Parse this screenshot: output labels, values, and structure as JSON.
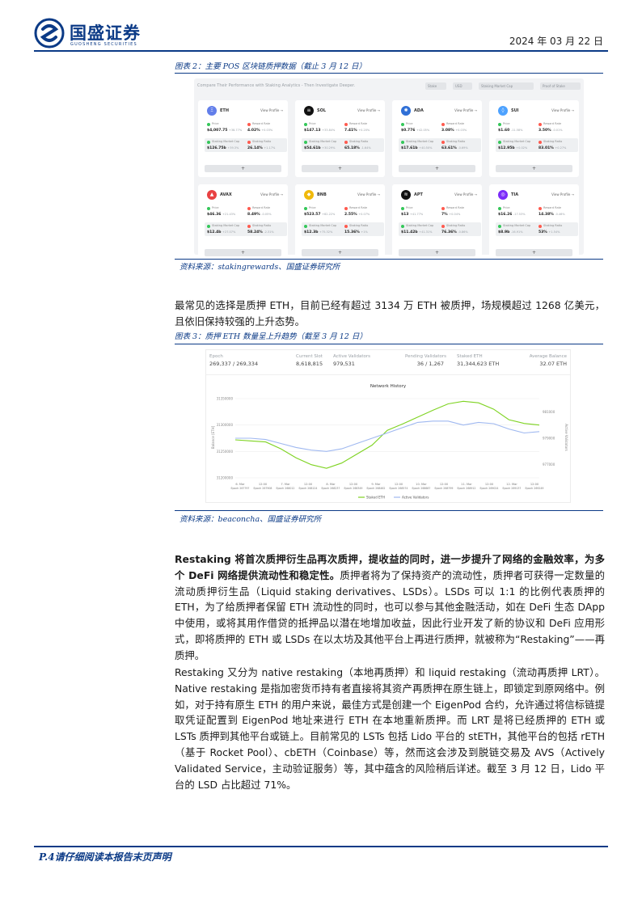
{
  "header": {
    "logo_text": "国盛证券",
    "logo_sub": "GUOSHENG SECURITIES",
    "date": "2024 年 03 月 22 日"
  },
  "figure2": {
    "caption": "图表 2：主要 POS 区块链质押数据（截止 3 月 12 日）",
    "source": "资料来源：stakingrewards、国盛证券研究所",
    "dashboard": {
      "heading": "Compare Their Performance with Staking Analytics - Then Investigate Deeper.",
      "filters": [
        "Stake",
        "USD",
        "Staking Market Cap",
        "Proof of Stake"
      ],
      "view_label": "View Profile →",
      "plus": "+",
      "metric_labels": [
        "Price",
        "Reward Rate",
        "Staking Market Cap",
        "Staking Ratio"
      ],
      "cards": [
        {
          "name": "ETH",
          "icon": "Ξ",
          "color": "#627eea",
          "price": "$4,007.75",
          "price_chg": "+38.77%",
          "reward": "4.02%",
          "reward_chg": "+0.03%",
          "mcap": "$126.75b",
          "mcap_chg": "+39.3%",
          "ratio": "26.14%",
          "ratio_chg": "+1.17%"
        },
        {
          "name": "SOL",
          "icon": "≡",
          "color": "#111111",
          "price": "$147.13",
          "price_chg": "+33.84%",
          "reward": "7.41%",
          "reward_chg": "+0.20%",
          "mcap": "$54.61b",
          "mcap_chg": "+30.29%",
          "ratio": "65.18%",
          "ratio_chg": "-1.64%"
        },
        {
          "name": "ADA",
          "icon": "✺",
          "color": "#2f6fd6",
          "price": "$0.776",
          "price_chg": "+42.05%",
          "reward": "3.08%",
          "reward_chg": "+0.03%",
          "mcap": "$17.61b",
          "mcap_chg": "+40.50%",
          "ratio": "63.61%",
          "ratio_chg": "-0.69%"
        },
        {
          "name": "SUI",
          "icon": "◊",
          "color": "#4da2ff",
          "price": "$1.60",
          "price_chg": "-11.58%",
          "reward": "3.50%",
          "reward_chg": "-0.01%",
          "mcap": "$12.95b",
          "mcap_chg": "+0.02%",
          "ratio": "83.01%",
          "ratio_chg": "+0.27%"
        },
        {
          "name": "AVAX",
          "icon": "▲",
          "color": "#e84142",
          "price": "$46.36",
          "price_chg": "+21.43%",
          "reward": "8.49%",
          "reward_chg": "-0.05%",
          "mcap": "$12.4b",
          "mcap_chg": "+27.07%",
          "ratio": "58.24%",
          "ratio_chg": "-2.31%"
        },
        {
          "name": "BNB",
          "icon": "◆",
          "color": "#f0b90b",
          "price": "$523.57",
          "price_chg": "+82.22%",
          "reward": "2.55%",
          "reward_chg": "+0.07%",
          "mcap": "$12.3b",
          "mcap_chg": "+75.32%",
          "ratio": "15.36%",
          "ratio_chg": "+1%"
        },
        {
          "name": "APT",
          "icon": "≋",
          "color": "#111111",
          "price": "$13",
          "price_chg": "+41.77%",
          "reward": "7%",
          "reward_chg": "+0.04%",
          "mcap": "$11.42b",
          "mcap_chg": "+41.31%",
          "ratio": "76.36%",
          "ratio_chg": "-0.86%"
        },
        {
          "name": "TIA",
          "icon": "◎",
          "color": "#7b2bf9",
          "price": "$16.26",
          "price_chg": "-17.53%",
          "reward": "14.38%",
          "reward_chg": "-0.46%",
          "mcap": "$8.9b",
          "mcap_chg": "-16.91%",
          "ratio": "53%",
          "ratio_chg": "+1.54%"
        }
      ]
    }
  },
  "paragraph1": "最常见的选择是质押 ETH，目前已经有超过 3134 万 ETH 被质押，场规模超过 1268 亿美元，且依旧保持较强的上升态势。",
  "figure3": {
    "caption": "图表 3：质押 ETH 数量呈上升趋势（截至 3 月 12 日）",
    "source": "资料来源：beaconcha、国盛证券研究所",
    "stats": [
      {
        "label": "Epoch",
        "value": "269,337 / 269,334"
      },
      {
        "label": "Current Slot",
        "value": "8,618,815"
      },
      {
        "label": "Active Validators",
        "value": "979,531"
      },
      {
        "label": "Pending Validators",
        "value": "36 / 1,267"
      },
      {
        "label": "Staked ETH",
        "value": "31,344,623 ETH"
      },
      {
        "label": "Average Balance",
        "value": "32.07 ETH"
      }
    ]
  },
  "chart_data": {
    "type": "line",
    "title": "Network History",
    "ylabel": "Balance [ETH]",
    "y2label": "Active Validators",
    "x": [
      "6. Mar",
      "12:00",
      "7. Mar",
      "12:00",
      "8. Mar",
      "12:00",
      "9. Mar",
      "12:00",
      "10. Mar",
      "12:00",
      "11. Mar",
      "12:00",
      "12. Mar",
      "12:00"
    ],
    "x_epochs": [
      "Epoch 267797",
      "Epoch 267908",
      "Epoch 268012",
      "Epoch 268124",
      "Epoch 268237",
      "Epoch 268349",
      "Epoch 268462",
      "Epoch 268574",
      "Epoch 268687",
      "Epoch 268799",
      "Epoch 268912",
      "Epoch 269024",
      "Epoch 269137",
      "Epoch 269249"
    ],
    "y_ticks": [
      "31200000",
      "31250000",
      "31300000",
      "31350000"
    ],
    "ylim": [
      31200000,
      31350000
    ],
    "y2_ticks": [
      "977000",
      "979000",
      "981000"
    ],
    "y2lim": [
      976000,
      982000
    ],
    "series": [
      {
        "name": "Staked ETH",
        "color": "#7ed321",
        "axis": "left",
        "values": [
          31272000,
          31270000,
          31268000,
          31255000,
          31238000,
          31225000,
          31218000,
          31228000,
          31245000,
          31262000,
          31290000,
          31302000,
          31315000,
          31328000,
          31340000,
          31345000,
          31342000,
          31330000,
          31310000,
          31303000,
          31300000
        ]
      },
      {
        "name": "Active Validators",
        "color": "#9fb8f0",
        "axis": "right",
        "values": [
          979000,
          979000,
          978900,
          978600,
          978300,
          978100,
          978000,
          978200,
          978600,
          979000,
          979400,
          979800,
          980200,
          980300,
          980300,
          980000,
          980200,
          980100,
          979700,
          979400,
          979500
        ]
      }
    ],
    "legend": "bottom"
  },
  "paragraph2": {
    "bold": "Restaking 将首次质押衍生品再次质押，提收益的同时，进一步提升了网络的金融效率，为多个 DeFi 网络提供流动性和稳定性。",
    "rest": "质押者将为了保持资产的流动性，质押者可获得一定数量的流动质押衍生品（Liquid staking derivatives、LSDs）。LSDs 可以 1:1 的比例代表质押的 ETH，为了给质押者保留 ETH 流动性的同时，也可以参与其他金融活动，如在 DeFi 生态 DApp 中使用，或将其用作借贷的抵押品以潜在地增加收益，因此行业开发了新的协议和 DeFi 应用形式，即将质押的 ETH 或 LSDs 在以太坊及其他平台上再进行质押，就被称为“Restaking”——再质押。"
  },
  "paragraph3": "Restaking 又分为 native restaking（本地再质押）和 liquid restaking（流动再质押 LRT）。Native restaking 是指加密货币持有者直接将其资产再质押在原生链上，即锁定到原网络中。例如，对于持有原生 ETH 的用户来说，最佳方式是创建一个 EigenPod 合约，允许通过将信标链提取凭证配置到 EigenPod 地址来进行 ETH 在本地重新质押。而 LRT 是将已经质押的 ETH 或 LSTs 质押到其他平台或链上。目前常见的 LSTs 包括 Lido 平台的 stETH，其他平台的包括 rETH（基于 Rocket Pool）、cbETH（Coinbase）等，然而这会涉及到脱链交易及 AVS（Actively Validated Service，主动验证服务）等，其中蕴含的风险稍后详述。截至 3 月 12 日，Lido 平台的 LSD 占比超过 71%。",
  "footer": {
    "text": "P.4请仔细阅读本报告末页声明"
  }
}
